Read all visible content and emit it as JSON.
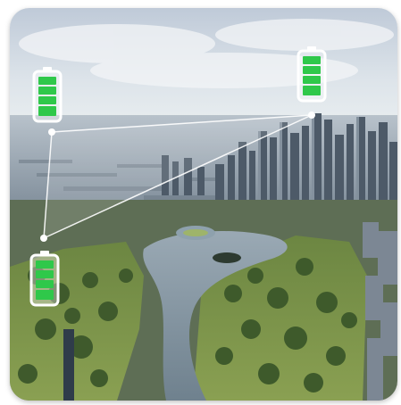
{
  "colors": {
    "sky_top": "#cdd7e3",
    "sky_horizon": "#e6ecef",
    "city_far": "#8b98a6",
    "city_near": "#3f4d5c",
    "river": "#7d8f9c",
    "park": "#7d9548",
    "park_dark": "#566d34",
    "battery_green": "#2fc84a",
    "battery_frame": "#ffffff",
    "link_line": "#ffffff"
  },
  "icons": {
    "battery_a": "battery-full-icon",
    "battery_b": "battery-full-icon",
    "battery_c": "battery-full-icon"
  },
  "batteries": [
    {
      "level": 1.0
    },
    {
      "level": 1.0
    },
    {
      "level": 1.0
    }
  ]
}
